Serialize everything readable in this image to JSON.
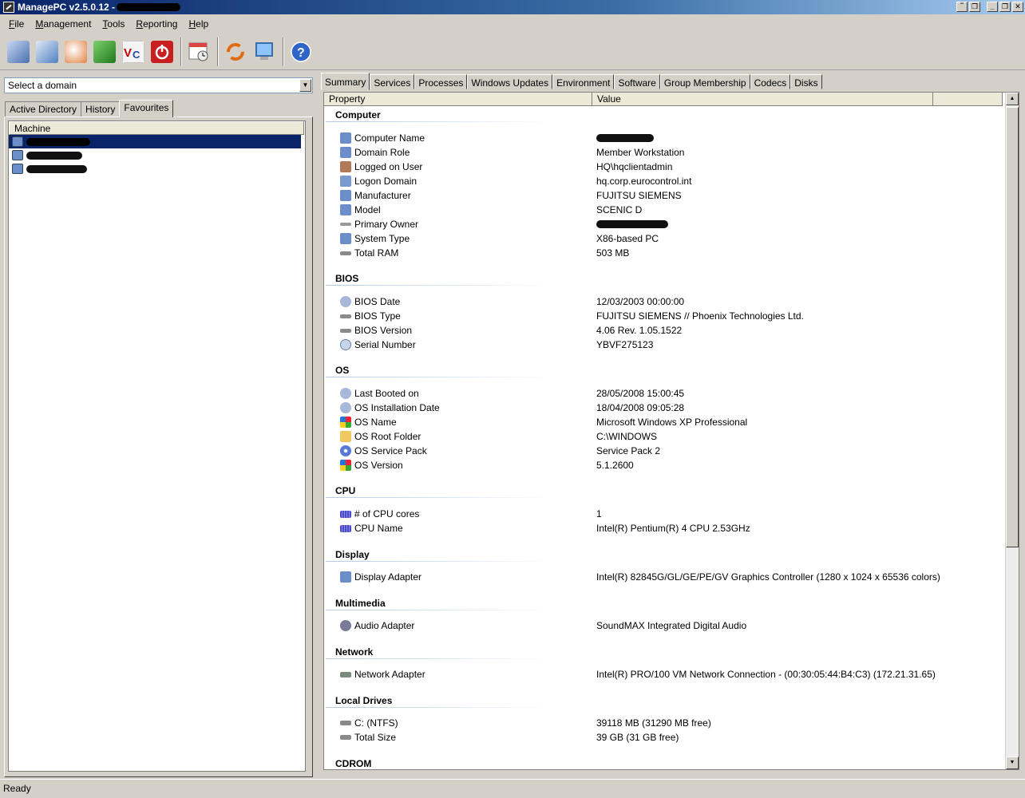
{
  "window": {
    "title": "ManagePC v2.5.0.12 -"
  },
  "menu": [
    {
      "key": "F",
      "rest": "ile"
    },
    {
      "key": "M",
      "rest": "anagement"
    },
    {
      "key": "T",
      "rest": "ools"
    },
    {
      "key": "R",
      "rest": "eporting"
    },
    {
      "key": "H",
      "rest": "elp"
    }
  ],
  "domain": {
    "placeholder": "Select a domain"
  },
  "left_tabs": [
    "Active Directory",
    "History",
    "Favourites"
  ],
  "machine_list": {
    "header": "Machine"
  },
  "right_tabs": [
    "Summary",
    "Services",
    "Processes",
    "Windows Updates",
    "Environment",
    "Software",
    "Group Membership",
    "Codecs",
    "Disks"
  ],
  "grid": {
    "col_property": "Property",
    "col_value": "Value"
  },
  "groups": {
    "computer": {
      "title": "Computer",
      "rows": [
        {
          "name": "Computer Name",
          "value": ""
        },
        {
          "name": "Domain Role",
          "value": "Member Workstation"
        },
        {
          "name": "Logged on User",
          "value": "HQ\\hqclientadmin"
        },
        {
          "name": "Logon Domain",
          "value": "hq.corp.eurocontrol.int"
        },
        {
          "name": "Manufacturer",
          "value": "FUJITSU SIEMENS"
        },
        {
          "name": "Model",
          "value": "SCENIC D"
        },
        {
          "name": "Primary Owner",
          "value": ""
        },
        {
          "name": "System Type",
          "value": "X86-based PC"
        },
        {
          "name": "Total RAM",
          "value": "503 MB"
        }
      ]
    },
    "bios": {
      "title": "BIOS",
      "rows": [
        {
          "name": "BIOS Date",
          "value": "12/03/2003 00:00:00"
        },
        {
          "name": "BIOS Type",
          "value": "FUJITSU SIEMENS // Phoenix Technologies Ltd."
        },
        {
          "name": "BIOS Version",
          "value": "4.06  Rev. 1.05.1522"
        },
        {
          "name": "Serial Number",
          "value": "YBVF275123"
        }
      ]
    },
    "os": {
      "title": "OS",
      "rows": [
        {
          "name": "Last Booted on",
          "value": "28/05/2008 15:00:45"
        },
        {
          "name": "OS Installation Date",
          "value": "18/04/2008 09:05:28"
        },
        {
          "name": "OS Name",
          "value": "Microsoft Windows XP Professional"
        },
        {
          "name": "OS Root Folder",
          "value": "C:\\WINDOWS"
        },
        {
          "name": "OS Service Pack",
          "value": "Service Pack 2"
        },
        {
          "name": "OS Version",
          "value": "5.1.2600"
        }
      ]
    },
    "cpu": {
      "title": "CPU",
      "rows": [
        {
          "name": "# of CPU cores",
          "value": "1"
        },
        {
          "name": "CPU Name",
          "value": "Intel(R) Pentium(R) 4 CPU 2.53GHz"
        }
      ]
    },
    "display": {
      "title": "Display",
      "rows": [
        {
          "name": "Display Adapter",
          "value": "Intel(R) 82845G/GL/GE/PE/GV Graphics Controller (1280 x 1024 x 65536 colors)"
        }
      ]
    },
    "multimedia": {
      "title": "Multimedia",
      "rows": [
        {
          "name": "Audio Adapter",
          "value": "SoundMAX Integrated Digital Audio"
        }
      ]
    },
    "network": {
      "title": "Network",
      "rows": [
        {
          "name": "Network Adapter",
          "value": "Intel(R) PRO/100 VM Network Connection -   (00:30:05:44:B4:C3)  (172.21.31.65)"
        }
      ]
    },
    "drives": {
      "title": "Local Drives",
      "rows": [
        {
          "name": "C: (NTFS)",
          "value": "39118 MB (31290 MB free)"
        },
        {
          "name": "Total Size",
          "value": "39 GB (31 GB free)"
        }
      ]
    },
    "cdrom": {
      "title": "CDROM"
    }
  },
  "status": {
    "text": "Ready"
  },
  "colors": {
    "title_start": "#0a246a",
    "selection": "#0a246a",
    "chrome": "#d4d0c8"
  }
}
